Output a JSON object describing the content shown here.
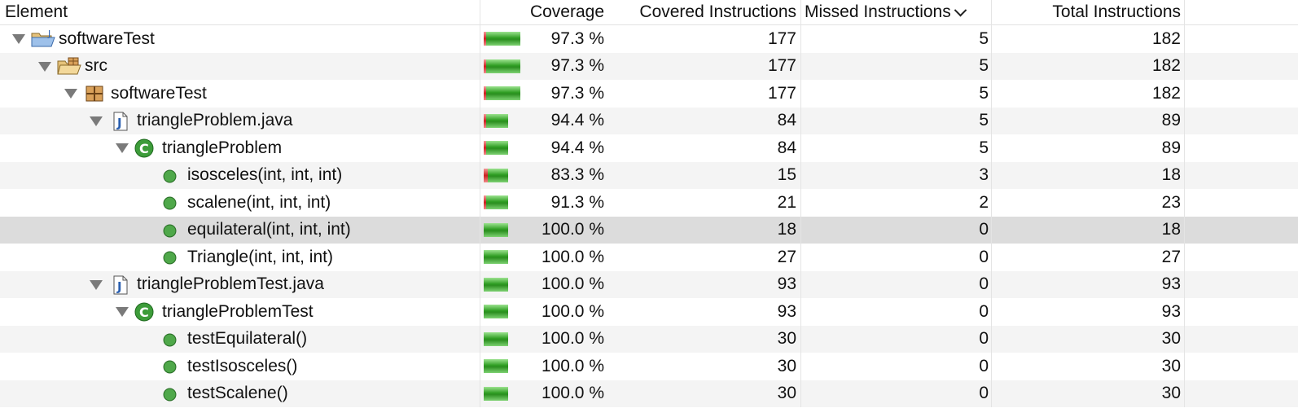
{
  "headers": {
    "element": "Element",
    "coverage": "Coverage",
    "covered": "Covered Instructions",
    "missed": "Missed Instructions",
    "total": "Total Instructions"
  },
  "rows": [
    {
      "name": "softwareTest",
      "icon": "project-folder-icon",
      "coverage": "97.3 %",
      "covered": "177",
      "missed": "5",
      "total": "182",
      "ratio": 0.973
    },
    {
      "name": "src",
      "icon": "source-folder-icon",
      "coverage": "97.3 %",
      "covered": "177",
      "missed": "5",
      "total": "182",
      "ratio": 0.973
    },
    {
      "name": "softwareTest",
      "icon": "package-icon",
      "coverage": "97.3 %",
      "covered": "177",
      "missed": "5",
      "total": "182",
      "ratio": 0.973
    },
    {
      "name": "triangleProblem.java",
      "icon": "java-file-icon",
      "coverage": "94.4 %",
      "covered": "84",
      "missed": "5",
      "total": "89",
      "ratio": 0.944
    },
    {
      "name": "triangleProblem",
      "icon": "class-icon",
      "coverage": "94.4 %",
      "covered": "84",
      "missed": "5",
      "total": "89",
      "ratio": 0.944
    },
    {
      "name": "isosceles(int, int, int)",
      "icon": "method-icon",
      "coverage": "83.3 %",
      "covered": "15",
      "missed": "3",
      "total": "18",
      "ratio": 0.833
    },
    {
      "name": "scalene(int, int, int)",
      "icon": "method-icon",
      "coverage": "91.3 %",
      "covered": "21",
      "missed": "2",
      "total": "23",
      "ratio": 0.913
    },
    {
      "name": "equilateral(int, int, int)",
      "icon": "method-icon",
      "coverage": "100.0 %",
      "covered": "18",
      "missed": "0",
      "total": "18",
      "ratio": 1.0
    },
    {
      "name": "Triangle(int, int, int)",
      "icon": "method-icon",
      "coverage": "100.0 %",
      "covered": "27",
      "missed": "0",
      "total": "27",
      "ratio": 1.0
    },
    {
      "name": "triangleProblemTest.java",
      "icon": "java-file-icon",
      "coverage": "100.0 %",
      "covered": "93",
      "missed": "0",
      "total": "93",
      "ratio": 1.0
    },
    {
      "name": "triangleProblemTest",
      "icon": "class-icon",
      "coverage": "100.0 %",
      "covered": "93",
      "missed": "0",
      "total": "93",
      "ratio": 1.0
    },
    {
      "name": "testEquilateral()",
      "icon": "method-icon",
      "coverage": "100.0 %",
      "covered": "30",
      "missed": "0",
      "total": "30",
      "ratio": 1.0
    },
    {
      "name": "testIsosceles()",
      "icon": "method-icon",
      "coverage": "100.0 %",
      "covered": "30",
      "missed": "0",
      "total": "30",
      "ratio": 1.0
    },
    {
      "name": "testScalene()",
      "icon": "method-icon",
      "coverage": "100.0 %",
      "covered": "30",
      "missed": "0",
      "total": "30",
      "ratio": 1.0
    }
  ]
}
